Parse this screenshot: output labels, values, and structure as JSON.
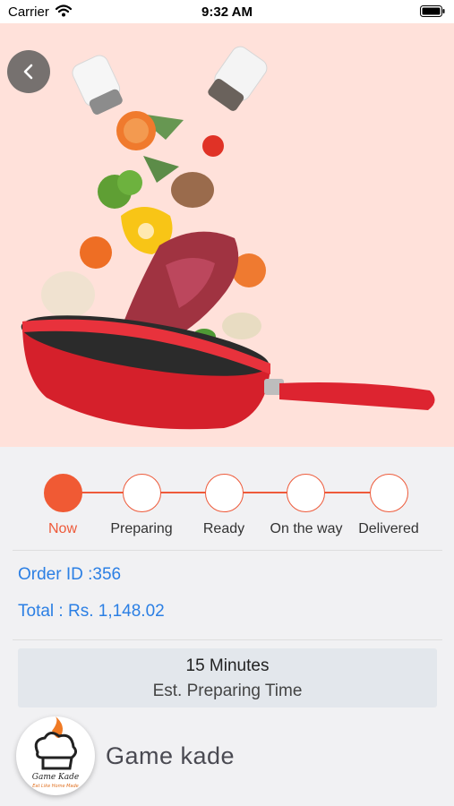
{
  "status_bar": {
    "carrier": "Carrier",
    "time": "9:32 AM"
  },
  "hero": {
    "back_icon": "chevron-left-icon",
    "image": "food-pan-photo"
  },
  "progress": {
    "accent_color": "#ee5a3a",
    "current_step": 0,
    "steps": [
      {
        "label": "Now"
      },
      {
        "label": "Preparing"
      },
      {
        "label": "Ready"
      },
      {
        "label": "On the way"
      },
      {
        "label": "Delivered"
      }
    ]
  },
  "order": {
    "id_text": "Order ID :356",
    "total_text": "Total : Rs. 1,148.02",
    "text_color": "#2b7fe4"
  },
  "prep_time": {
    "value": "15 Minutes",
    "label": "Est. Preparing Time"
  },
  "restaurant": {
    "name": "Game kade",
    "logo_title": "Game Kade",
    "logo_tagline": "Eat Like Home Made"
  }
}
